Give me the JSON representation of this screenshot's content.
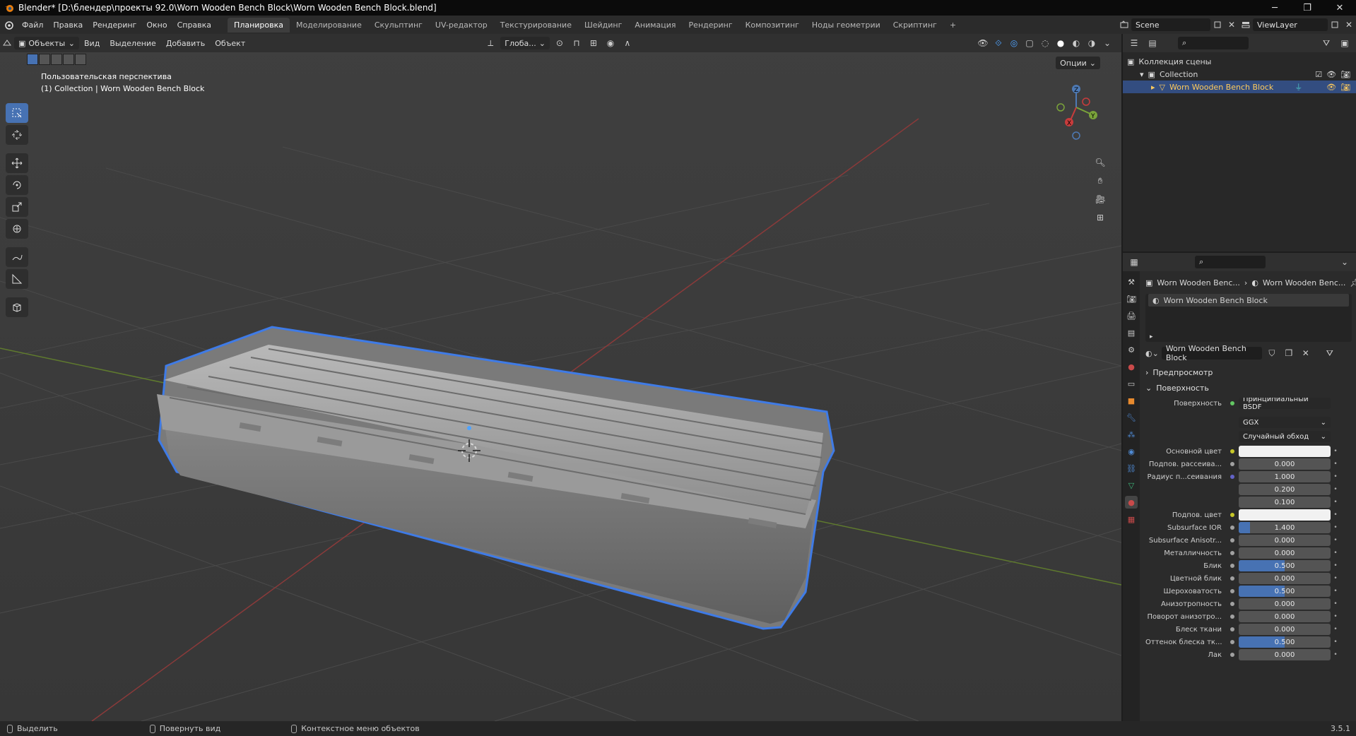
{
  "window": {
    "title": "Blender* [D:\\блендер\\проекты 92.0\\Worn Wooden Bench Block\\Worn Wooden Bench Block.blend]",
    "minimize": "─",
    "maximize": "❐",
    "close": "✕"
  },
  "menu": [
    "Файл",
    "Правка",
    "Рендеринг",
    "Окно",
    "Справка"
  ],
  "workspaces": [
    "Планировка",
    "Моделирование",
    "Скульптинг",
    "UV-редактор",
    "Текстурирование",
    "Шейдинг",
    "Анимация",
    "Рендеринг",
    "Композитинг",
    "Ноды геометрии",
    "Скриптинг",
    "+"
  ],
  "scene": {
    "name": "Scene",
    "view_layer": "ViewLayer"
  },
  "viewport": {
    "mode": "Объекты",
    "menu": [
      "Вид",
      "Выделение",
      "Добавить",
      "Объект"
    ],
    "orientation": "Глоба...",
    "options_label": "Опции",
    "info_line1": "Пользовательская перспектива",
    "info_line2": "(1) Collection | Worn Wooden Bench Block",
    "gizmo": {
      "x": "X",
      "y": "Y",
      "z": "Z"
    }
  },
  "outliner": {
    "root": "Коллекция сцены",
    "collection": "Collection",
    "object": "Worn Wooden Bench Block"
  },
  "properties": {
    "breadcrumb_object": "Worn Wooden Benc...",
    "breadcrumb_material": "Worn Wooden Benc...",
    "material_slot": "Worn Wooden Bench Block",
    "material_name": "Worn Wooden Bench Block",
    "panel_preview": "Предпросмотр",
    "panel_surface": "Поверхность",
    "surface_label": "Поверхность",
    "surface_value": "Принципиальный BSDF",
    "distribution": "GGX",
    "subsurface_method": "Случайный обход",
    "rows": [
      {
        "label": "Основной цвет",
        "type": "color",
        "socket": "yellow"
      },
      {
        "label": "Подпов. рассеива...",
        "type": "num",
        "value": "0.000",
        "fill": 0,
        "socket": "gray"
      },
      {
        "label": "Радиус п...сеивания",
        "type": "num",
        "value": "1.000",
        "fill": 0,
        "socket": "blue"
      },
      {
        "label": "",
        "type": "num",
        "value": "0.200",
        "fill": 0,
        "socket": "none"
      },
      {
        "label": "",
        "type": "num",
        "value": "0.100",
        "fill": 0,
        "socket": "none"
      },
      {
        "label": "Подпов. цвет",
        "type": "color",
        "socket": "yellow"
      },
      {
        "label": "Subsurface IOR",
        "type": "num",
        "value": "1.400",
        "fill": 0.12,
        "socket": "gray"
      },
      {
        "label": "Subsurface Anisotr...",
        "type": "num",
        "value": "0.000",
        "fill": 0,
        "socket": "gray"
      },
      {
        "label": "Металличность",
        "type": "num",
        "value": "0.000",
        "fill": 0,
        "socket": "gray"
      },
      {
        "label": "Блик",
        "type": "num",
        "value": "0.500",
        "fill": 0.5,
        "socket": "gray"
      },
      {
        "label": "Цветной блик",
        "type": "num",
        "value": "0.000",
        "fill": 0,
        "socket": "gray"
      },
      {
        "label": "Шероховатость",
        "type": "num",
        "value": "0.500",
        "fill": 0.5,
        "socket": "gray"
      },
      {
        "label": "Анизотропность",
        "type": "num",
        "value": "0.000",
        "fill": 0,
        "socket": "gray"
      },
      {
        "label": "Поворот анизотро...",
        "type": "num",
        "value": "0.000",
        "fill": 0,
        "socket": "gray"
      },
      {
        "label": "Блеск ткани",
        "type": "num",
        "value": "0.000",
        "fill": 0,
        "socket": "gray"
      },
      {
        "label": "Оттенок блеска тк...",
        "type": "num",
        "value": "0.500",
        "fill": 0.5,
        "socket": "gray"
      },
      {
        "label": "Лак",
        "type": "num",
        "value": "0.000",
        "fill": 0,
        "socket": "gray"
      }
    ]
  },
  "statusbar": {
    "select": "Выделить",
    "rotate": "Повернуть вид",
    "context": "Контекстное меню объектов",
    "version": "3.5.1"
  },
  "colors": {
    "accent": "#4772b3",
    "selection_outline": "#3f7be6",
    "outliner_selected": "#334d80",
    "axis_x": "#c83c3c",
    "axis_y": "#7aa33a"
  }
}
